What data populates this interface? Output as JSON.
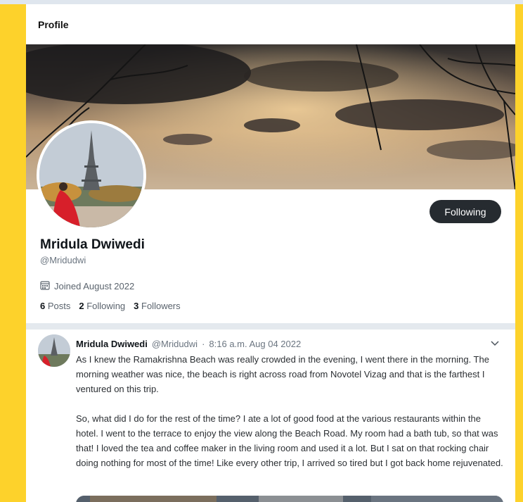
{
  "header": {
    "title": "Profile"
  },
  "profile": {
    "name": "Mridula Dwiwedi",
    "handle": "@Mridudwi",
    "joined": "Joined August 2022",
    "follow_button": "Following",
    "stats": {
      "posts_count": "6",
      "posts_label": "Posts",
      "following_count": "2",
      "following_label": "Following",
      "followers_count": "3",
      "followers_label": "Followers"
    }
  },
  "post": {
    "author": "Mridula Dwiwedi",
    "handle": "@Mridudwi",
    "separator": "·",
    "time": "8:16 a.m. Aug 04 2022",
    "paragraphs": [
      "As I knew the Ramakrishna Beach was really crowded in the evening, I went there in the morning. The morning weather was nice, the beach is right across road from Novotel Vizag and that is the farthest I ventured on this trip.",
      "So, what did I do for the rest of the time? I ate a lot of good food at the various restaurants within the hotel. I went to the terrace to enjoy the view along the Beach Road. My room had a bath tub, so that was that! I loved the tea and coffee maker in the living room and used it a lot. But I sat on that rocking chair doing nothing for most of the time! Like every other trip, I arrived so tired but I got back home rejuvenated."
    ]
  },
  "icons": {
    "joined": "calendar-icon",
    "menu": "chevron-down-icon"
  },
  "colors": {
    "accent_yellow": "#fdd22b",
    "button_dark": "#262b30",
    "muted_text": "#6b7580"
  }
}
